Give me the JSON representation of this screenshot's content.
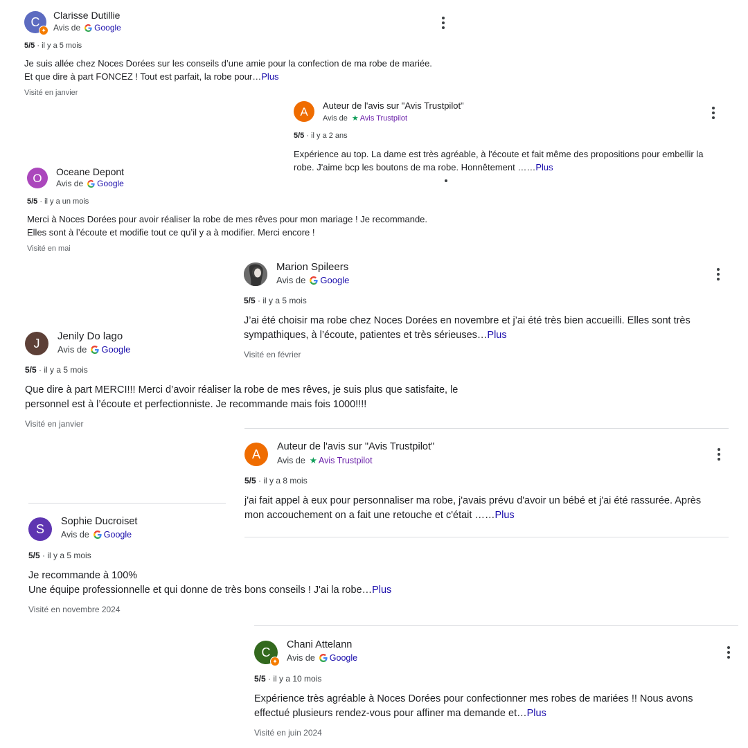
{
  "common": {
    "avis_de": "Avis de",
    "google": "Google",
    "trustpilot": "Avis Trustpilot",
    "more": "Plus"
  },
  "reviews": [
    {
      "author": "Clarisse Dutillie",
      "initial": "C",
      "avatar_color": "#5c6bc0",
      "local_guide": true,
      "source": "google",
      "rating": "5/5",
      "time": "il y a 5 mois",
      "text_line1": "Je suis allée chez Noces Dorées sur les conseils d’une amie pour la confection de ma robe de mariée.",
      "text_line2": "Et que dire à part FONCEZ ! Tout est parfait, la robe pour…",
      "visited": "Visité en janvier"
    },
    {
      "author": "Auteur de l'avis sur \"Avis Trustpilot\"",
      "initial": "A",
      "avatar_color": "#ef6c00",
      "local_guide": false,
      "source": "trustpilot",
      "rating": "5/5",
      "time": "il y a 2 ans",
      "text_line1": "Expérience au top. La dame est très agréable, à l'écoute et fait même des propositions pour embellir la",
      "text_line2": "robe. J'aime bcp les boutons de ma robe. Honnêtement ……",
      "visited": ""
    },
    {
      "author": "Oceane Depont",
      "initial": "O",
      "avatar_color": "#ab47bc",
      "local_guide": false,
      "source": "google",
      "rating": "5/5",
      "time": "il y a un mois",
      "text_line1": "Merci à Noces Dorées pour avoir réaliser la robe de mes rêves pour mon mariage ! Je recommande.",
      "text_line2": "Elles sont à l’écoute et modifie tout ce qu’il y a à modifier. Merci encore !",
      "visited": "Visité en mai"
    },
    {
      "author": "Marion Spileers",
      "initial": "",
      "avatar_color": "#4a4a4a",
      "local_guide": false,
      "source": "google",
      "rating": "5/5",
      "time": "il y a 5 mois",
      "text_line1": "J’ai été choisir ma robe chez Noces Dorées en novembre et j’ai été très bien accueilli. Elles sont très",
      "text_line2": "sympathiques, à l’écoute, patientes et très sérieuses…",
      "visited": "Visité en février"
    },
    {
      "author": "Jenily Do lago",
      "initial": "J",
      "avatar_color": "#5d4037",
      "local_guide": false,
      "source": "google",
      "rating": "5/5",
      "time": "il y a 5 mois",
      "text_line1": "Que dire à part MERCI!!! Merci d’avoir réaliser la robe de mes rêves, je suis plus que satisfaite, le",
      "text_line2": "personnel est à l’écoute et perfectionniste. Je recommande mais fois 1000!!!!",
      "visited": "Visité en janvier"
    },
    {
      "author": "Auteur de l'avis sur \"Avis Trustpilot\"",
      "initial": "A",
      "avatar_color": "#ef6c00",
      "local_guide": false,
      "source": "trustpilot",
      "rating": "5/5",
      "time": "il y a 8 mois",
      "text_line1": "j'ai fait appel à eux pour personnaliser ma robe, j'avais prévu d'avoir un bébé et j'ai été rassurée. Après",
      "text_line2": "mon accouchement on a fait une retouche et c'était ……",
      "visited": ""
    },
    {
      "author": "Sophie Ducroiset",
      "initial": "S",
      "avatar_color": "#5e35b1",
      "local_guide": false,
      "source": "google",
      "rating": "5/5",
      "time": "il y a 5 mois",
      "text_line1": "Je recommande à 100%",
      "text_line2": "Une équipe professionnelle et qui donne de très bons conseils ! J'ai la robe…",
      "visited": "Visité en novembre 2024"
    },
    {
      "author": "Chani Attelann",
      "initial": "C",
      "avatar_color": "#33691e",
      "local_guide": true,
      "source": "google",
      "rating": "5/5",
      "time": "il y a 10 mois",
      "text_line1": "Expérience très agréable à Noces Dorées pour confectionner mes robes de mariées !! Nous avons",
      "text_line2": "effectué plusieurs rendez-vous pour affiner ma demande et…",
      "visited": "Visité en juin 2024"
    }
  ]
}
